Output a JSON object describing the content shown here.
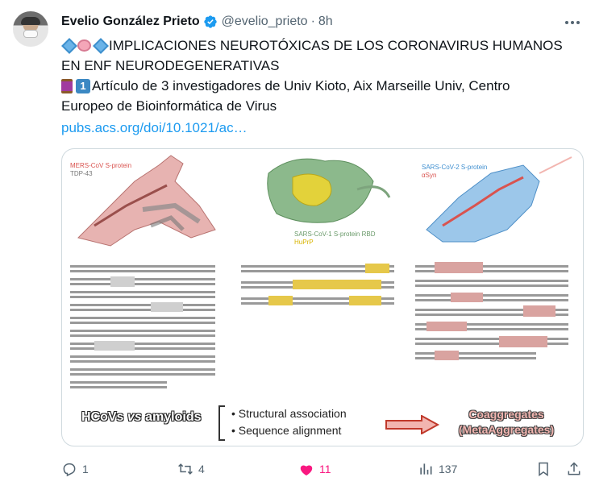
{
  "author": {
    "display_name": "Evelio González Prieto",
    "handle": "@evelio_prieto",
    "separator": "·",
    "time": "8h"
  },
  "tweet": {
    "line1": "IMPLICACIONES NEUROTÓXICAS DE LOS CORONAVIRUS HUMANOS",
    "line2": "EN ENF NEURODEGENERATIVAS",
    "line3": "Artículo de 3 investigadores de Univ Kioto, Aix Marseille Univ, Centro",
    "line4": "Europeo de Bioinformática de Virus",
    "keycap": "1",
    "link": "pubs.acs.org/doi/10.1021/ac…"
  },
  "figure": {
    "mers_label": "MERS-CoV S-protein",
    "tdp_label": "TDP-43",
    "sars1_label": "SARS-CoV-1 S-protein RBD",
    "huprp_label": "HuPrP",
    "sars2_label": "SARS-CoV-2 S-protein",
    "asyn_label": "αSyn",
    "left_text_a": "HCoVs",
    "left_text_vs": "vs",
    "left_text_b": "amyloids",
    "bullet1": "• Structural association",
    "bullet2": "• Sequence alignment",
    "result_line1": "Coaggregates",
    "result_line2": "(MetaAggregates)"
  },
  "actions": {
    "reply_count": "1",
    "retweet_count": "4",
    "like_count": "11",
    "views_count": "137"
  },
  "colors": {
    "accent": "#1d9bf0",
    "like": "#f91880",
    "secondary_text": "#536471"
  },
  "icons": [
    "verified-badge-icon",
    "more-icon",
    "reply-icon",
    "retweet-icon",
    "like-icon",
    "views-icon",
    "bookmark-icon",
    "share-icon"
  ]
}
